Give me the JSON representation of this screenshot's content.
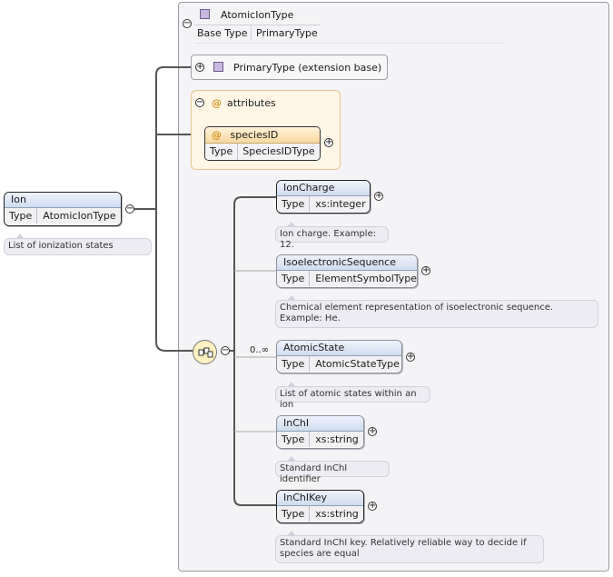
{
  "complex_type": {
    "icon": "complex-type-icon",
    "name": "AtomicIonType",
    "base_type_label": "Base Type",
    "base_type_value": "PrimaryType"
  },
  "extension": {
    "icon": "complex-type-icon",
    "label": "PrimaryType (extension base)"
  },
  "attributes_group": {
    "label": "attributes",
    "attribute": {
      "name": "speciesID",
      "type_label": "Type",
      "type_value": "SpeciesIDType"
    }
  },
  "root": {
    "name": "Ion",
    "type_label": "Type",
    "type_value": "AtomicIonType",
    "doc": "List of ionization states"
  },
  "sequence": {
    "cardinality": "0..∞"
  },
  "children": [
    {
      "name": "IonCharge",
      "type_label": "Type",
      "type_value": "xs:integer",
      "doc": "Ion charge. Example: 12."
    },
    {
      "name": "IsoelectronicSequence",
      "type_label": "Type",
      "type_value": "ElementSymbolType",
      "doc": "Chemical element representation of isoelectronic sequence. Example: He."
    },
    {
      "name": "AtomicState",
      "type_label": "Type",
      "type_value": "AtomicStateType",
      "doc": "List of atomic states within an ion"
    },
    {
      "name": "InChI",
      "type_label": "Type",
      "type_value": "xs:string",
      "doc": "Standard InChI identifier"
    },
    {
      "name": "InChIKey",
      "type_label": "Type",
      "type_value": "xs:string",
      "doc": "Standard InChI key. Relatively reliable way to decide if species are equal"
    }
  ],
  "colors": {
    "panel_bg": "#f4f4f6",
    "attr_bg": "#fff6e6",
    "element_header": "#cfdcf0",
    "doc_bg": "#ececf2"
  }
}
